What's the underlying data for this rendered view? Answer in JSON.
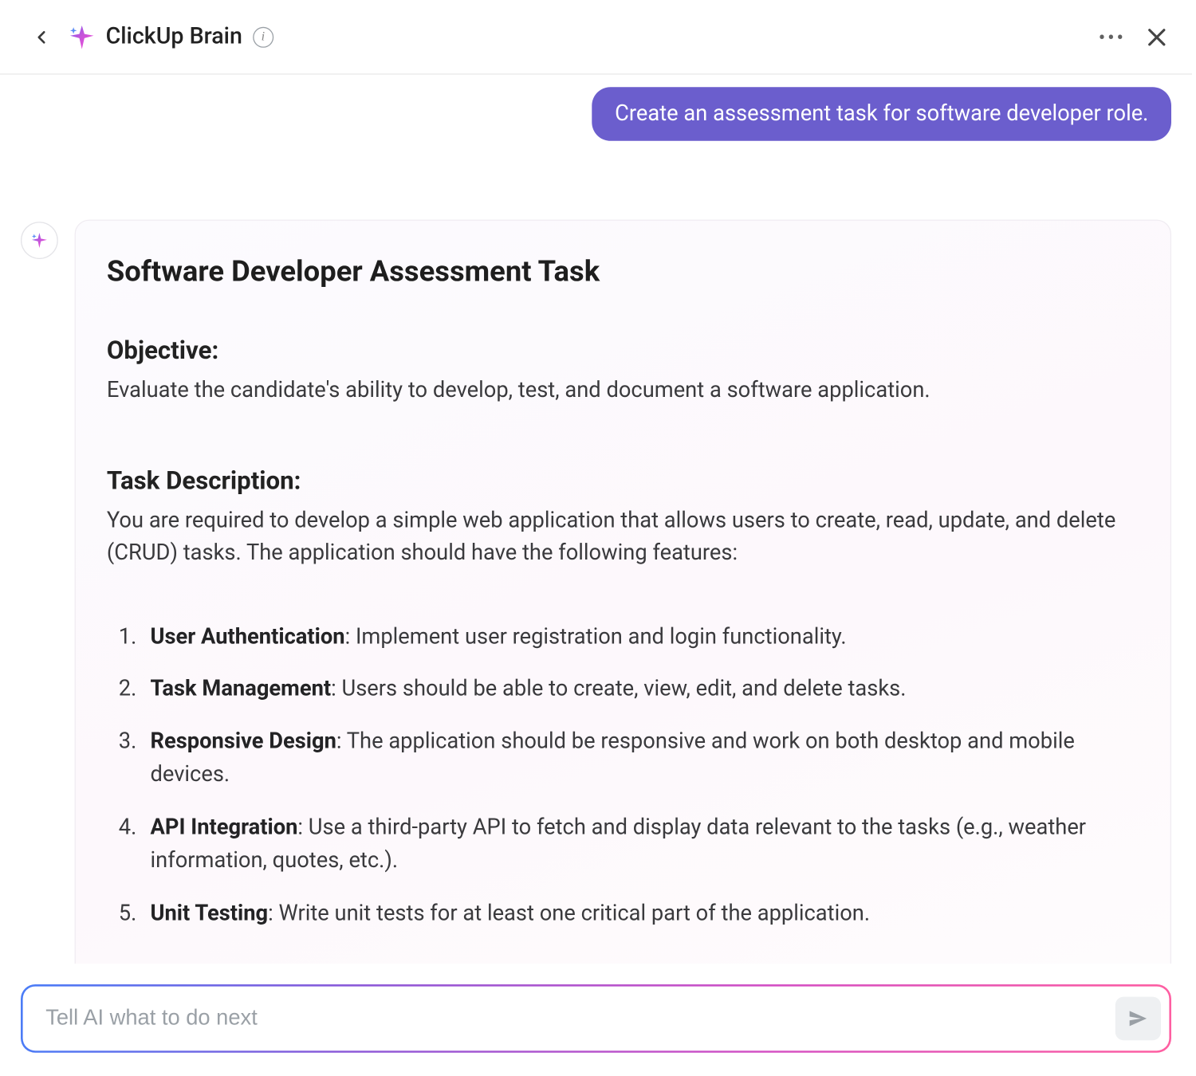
{
  "header": {
    "title": "ClickUp Brain"
  },
  "messages": {
    "user_prompt": "Create an assessment task for software developer role."
  },
  "response": {
    "title": "Software Developer Assessment Task",
    "sections": {
      "objective_heading": "Objective:",
      "objective_text": "Evaluate the candidate's ability to develop, test, and document a software application.",
      "task_desc_heading": "Task Description:",
      "task_desc_text": "You are required to develop a simple web application that allows users to create, read, update, and delete (CRUD) tasks. The application should have the following features:"
    },
    "features": [
      {
        "bold": "User Authentication",
        "rest": ": Implement user registration and login functionality."
      },
      {
        "bold": "Task Management",
        "rest": ": Users should be able to create, view, edit, and delete tasks."
      },
      {
        "bold": "Responsive Design",
        "rest": ": The application should be responsive and work on both desktop and mobile devices."
      },
      {
        "bold": "API Integration",
        "rest": ": Use a third-party API to fetch and display data relevant to the tasks (e.g., weather information, quotes, etc.)."
      },
      {
        "bold": "Unit Testing",
        "rest": ": Write unit tests for at least one critical part of the application."
      }
    ]
  },
  "input": {
    "placeholder": "Tell AI what to do next"
  }
}
